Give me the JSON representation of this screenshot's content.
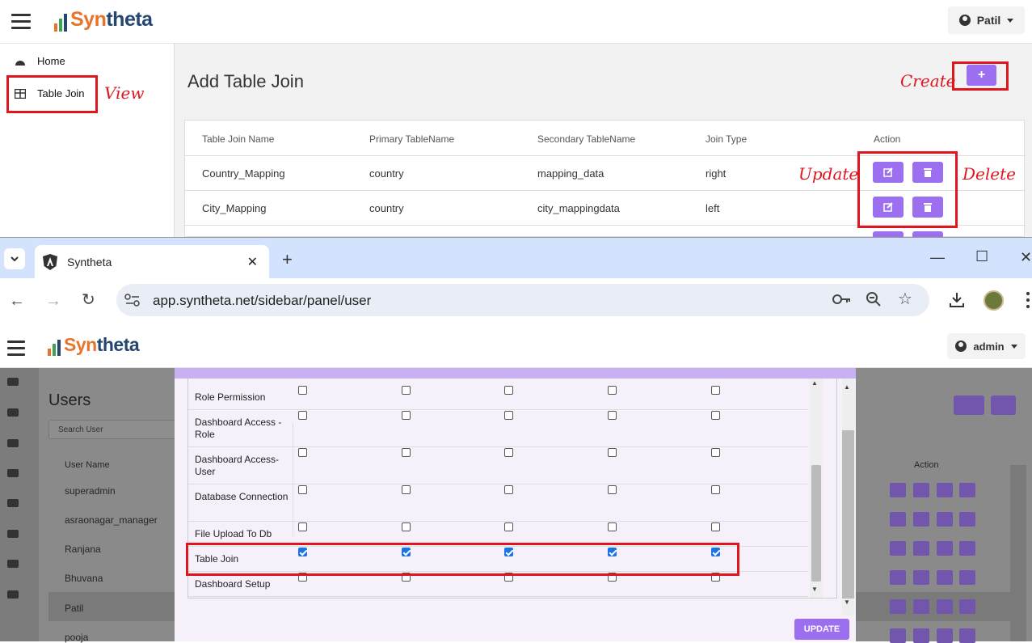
{
  "top_app": {
    "brand": {
      "part1": "Syn",
      "part2": "theta"
    },
    "user": "Patil",
    "sidebar": [
      {
        "label": "Home"
      },
      {
        "label": "Table Join"
      }
    ],
    "page_title": "Add Table Join",
    "create_button": "+",
    "table": {
      "headers": [
        "Table Join Name",
        "Primary TableName",
        "Secondary TableName",
        "Join Type",
        "Action"
      ],
      "rows": [
        [
          "Country_Mapping",
          "country",
          "mapping_data",
          "right"
        ],
        [
          "City_Mapping",
          "country",
          "city_mappingdata",
          "left"
        ]
      ]
    },
    "annotations": {
      "view": "View",
      "create": "Create",
      "update": "Update",
      "delete": "Delete"
    }
  },
  "browser": {
    "tab_title": "Syntheta",
    "new_tab": "+",
    "url": "app.syntheta.net/sidebar/panel/user",
    "window_controls": {
      "minimize": "—",
      "maximize": "☐",
      "close": "✕"
    }
  },
  "bottom_app": {
    "brand": {
      "part1": "Syn",
      "part2": "theta"
    },
    "user": "admin",
    "page_title": "Users",
    "search_placeholder": "Search User",
    "col_username": "User Name",
    "col_action": "Action",
    "users": [
      "superadmin",
      "asraonagar_manager",
      "Ranjana",
      "Bhuvana",
      "Patil",
      "pooja"
    ],
    "selected_user": "Patil",
    "permissions": [
      {
        "name": "Role Permission",
        "checks": [
          false,
          false,
          false,
          false,
          false
        ]
      },
      {
        "name": "Dashboard Access - Role",
        "checks": [
          false,
          false,
          false,
          false,
          false
        ]
      },
      {
        "name": "Dashboard Access- User",
        "checks": [
          false,
          false,
          false,
          false,
          false
        ]
      },
      {
        "name": "Database Connection",
        "checks": [
          false,
          false,
          false,
          false,
          false
        ]
      },
      {
        "name": "File Upload To Db",
        "checks": [
          false,
          false,
          false,
          false,
          false
        ]
      },
      {
        "name": "Table Join",
        "checks": [
          true,
          true,
          true,
          true,
          true
        ]
      },
      {
        "name": "Dashboard Setup",
        "checks": [
          false,
          false,
          false,
          false,
          false
        ]
      }
    ],
    "update_button": "UPDATE"
  },
  "colors": {
    "accent": "#9c6ff0",
    "annotation_red": "#e0161e",
    "chrome_tab": "#d3e3fd"
  }
}
